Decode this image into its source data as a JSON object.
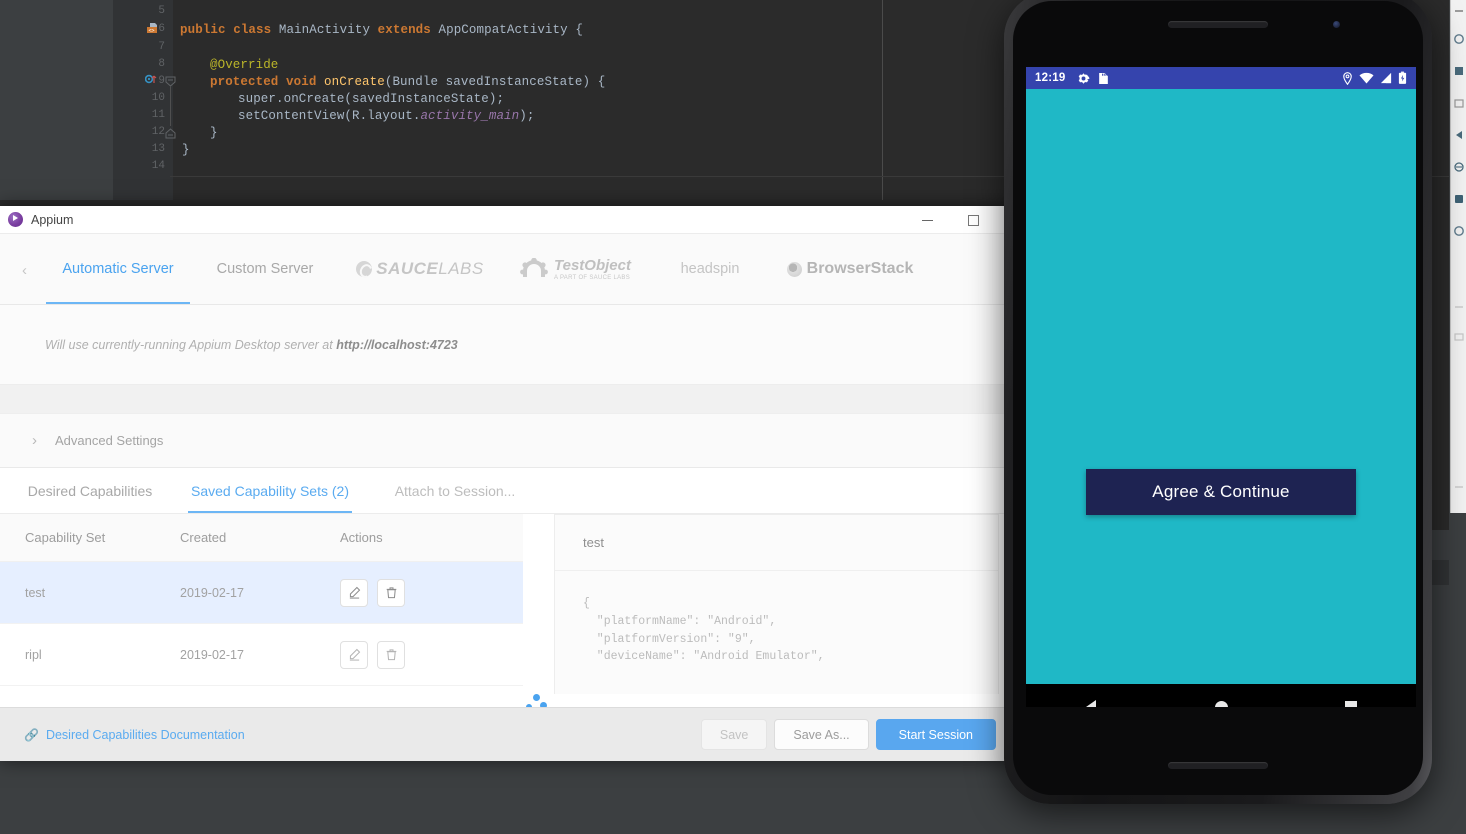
{
  "ide": {
    "line_numbers": [
      "5",
      "6",
      "7",
      "8",
      "9",
      "10",
      "11",
      "12",
      "13",
      "14"
    ],
    "code": [
      "public class MainActivity extends AppCompatActivity {",
      "@Override",
      "protected void onCreate(Bundle savedInstanceState) {",
      "super.onCreate(savedInstanceState);",
      "setContentView(R.layout.activity_main);",
      "}",
      "}"
    ],
    "tokens": {
      "kw_public": "public",
      "kw_class": "class",
      "type_mainactivity": "MainActivity",
      "kw_extends": "extends",
      "type_appcompat": "AppCompatActivity",
      "brace_open": " {",
      "annotation_override": "@Override",
      "kw_protected": "protected",
      "kw_void": "void",
      "fn_oncreate": "onCreate",
      "params_oncreate": "(Bundle savedInstanceState) {",
      "super_call": "super.onCreate(savedInstanceState);",
      "setcontentview_a": "setContentView(R.layout.",
      "setcontentview_field": "activity_main",
      "setcontentview_b": ");",
      "close_inner": "}",
      "close_outer": "}"
    }
  },
  "appium": {
    "window": {
      "title": "Appium",
      "logo_icon": "appium-logo-icon",
      "minimize_icon": "minimize-icon",
      "maximize_icon": "maximize-icon"
    },
    "server_tabs": {
      "prev_arrow_icon": "chevron-left-icon",
      "items": [
        {
          "label": "Automatic Server",
          "active": true
        },
        {
          "label": "Custom Server",
          "active": false
        },
        {
          "label": "SAUCE LABS",
          "label_part1": "SAUCE",
          "label_part2": "LABS",
          "active": false,
          "icon": "sauce-labs-swirl-icon"
        },
        {
          "label": "TestObject",
          "sublabel": "A PART OF SAUCE LABS",
          "active": false,
          "icon": "testobject-gear-icon"
        },
        {
          "label": "headspin",
          "active": false
        },
        {
          "label": "BrowserStack",
          "active": false,
          "icon": "browserstack-circle-icon"
        }
      ]
    },
    "server_info": {
      "message_prefix": "Will use currently-running Appium Desktop server at ",
      "server_url": "http://localhost:4723"
    },
    "advanced_settings": {
      "label": "Advanced Settings",
      "chevron_icon": "chevron-right-icon"
    },
    "cap_tabs": [
      {
        "label": "Desired Capabilities",
        "active": false
      },
      {
        "label": "Saved Capability Sets (2)",
        "active": true
      },
      {
        "label": "Attach to Session...",
        "active": false
      }
    ],
    "spinner_icon": "loading-dots-spinner",
    "table": {
      "headers": [
        "Capability Set",
        "Created",
        "Actions"
      ],
      "rows": [
        {
          "name": "test",
          "created": "2019-02-17",
          "selected": true,
          "edit_icon": "pencil-icon",
          "delete_icon": "trash-icon"
        },
        {
          "name": "ripl",
          "created": "2019-02-17",
          "selected": false,
          "edit_icon": "pencil-icon",
          "delete_icon": "trash-icon"
        }
      ]
    },
    "json_panel": {
      "title": "test",
      "content": "{\n  \"platformName\": \"Android\",\n  \"platformVersion\": \"9\",\n  \"deviceName\": \"Android Emulator\","
    },
    "footer": {
      "doc_link": "Desired Capabilities Documentation",
      "doc_link_icon": "link-icon",
      "save_label": "Save",
      "save_as_label": "Save As...",
      "start_session_label": "Start Session"
    },
    "colors": {
      "accent_blue": "#5aabf0",
      "tab_underline": "#6cb6f5",
      "row_selected": "#e6efff"
    }
  },
  "phone": {
    "status_bar": {
      "time": "12:19",
      "left_icons": [
        "gear-icon",
        "sdcard-icon"
      ],
      "right_icons": [
        "location-pin-icon",
        "wifi-icon",
        "signal-icon",
        "battery-charging-icon"
      ],
      "bg_color": "#3544ad"
    },
    "app": {
      "background_color": "#1fb8c6",
      "button_label": "Agree & Continue",
      "button_color": "#1e2352"
    },
    "nav_bar": {
      "back_icon": "nav-back-triangle-icon",
      "home_icon": "nav-home-circle-icon",
      "recents_icon": "nav-recents-square-icon"
    },
    "hardware": {
      "earpiece_icon": "earpiece-speaker",
      "front_camera_icon": "front-camera",
      "bottom_speaker_icon": "bottom-speaker"
    }
  }
}
